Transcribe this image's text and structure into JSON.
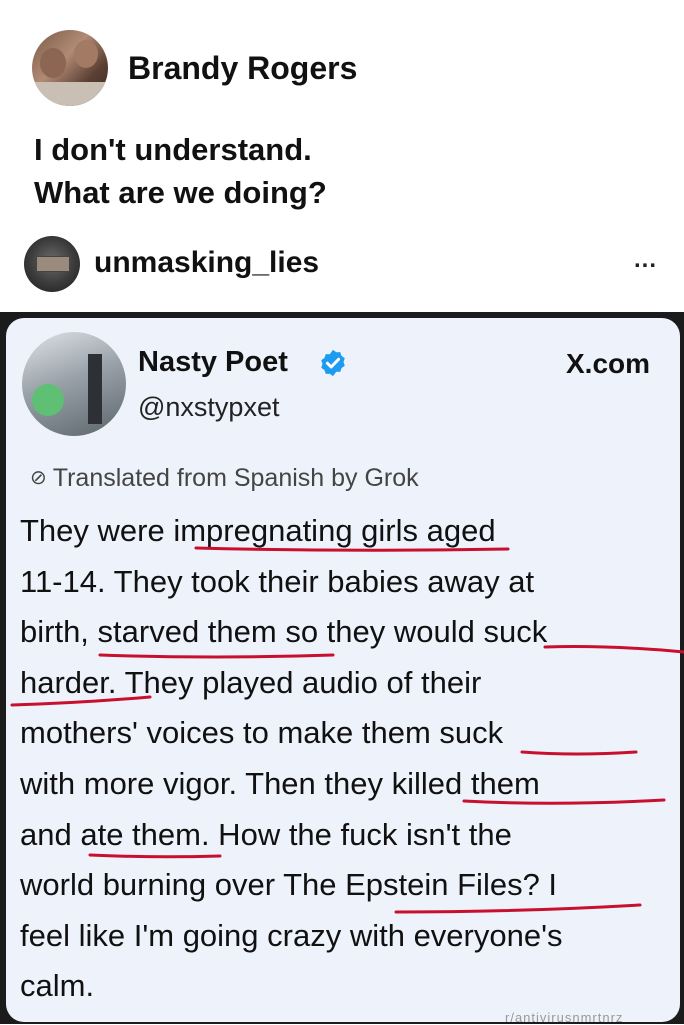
{
  "post": {
    "author": "Brandy Rogers",
    "text_line1": "I don't understand.",
    "text_line2": "What are we doing?"
  },
  "shared": {
    "account": "unmasking_lies",
    "more_label": "..."
  },
  "tweet": {
    "name": "Nasty Poet",
    "handle": "@nxstypxet",
    "source": "X.com",
    "translated": "Translated from Spanish by Grok",
    "lines": [
      "They were impregnating girls aged",
      "11-14. They took their babies away at",
      "birth, starved them so they would suck",
      "harder. They played audio of their",
      "mothers' voices to make them suck",
      "with more vigor. Then they killed them",
      "and ate them. How the fuck isn't the",
      "world burning over The Epstein Files? I",
      "feel like I'm going crazy with everyone's",
      "calm."
    ]
  },
  "watermark": "r/antivirusnmrtnrz",
  "icons": {
    "verified": "verified-badge-icon",
    "translate": "translate-globe-icon",
    "more": "more-options-icon"
  },
  "colors": {
    "verified_blue": "#1d9bf0",
    "underline_red": "#c8102e",
    "tweet_card_bg": "#eef3fb",
    "frame": "#1b1b1b"
  }
}
